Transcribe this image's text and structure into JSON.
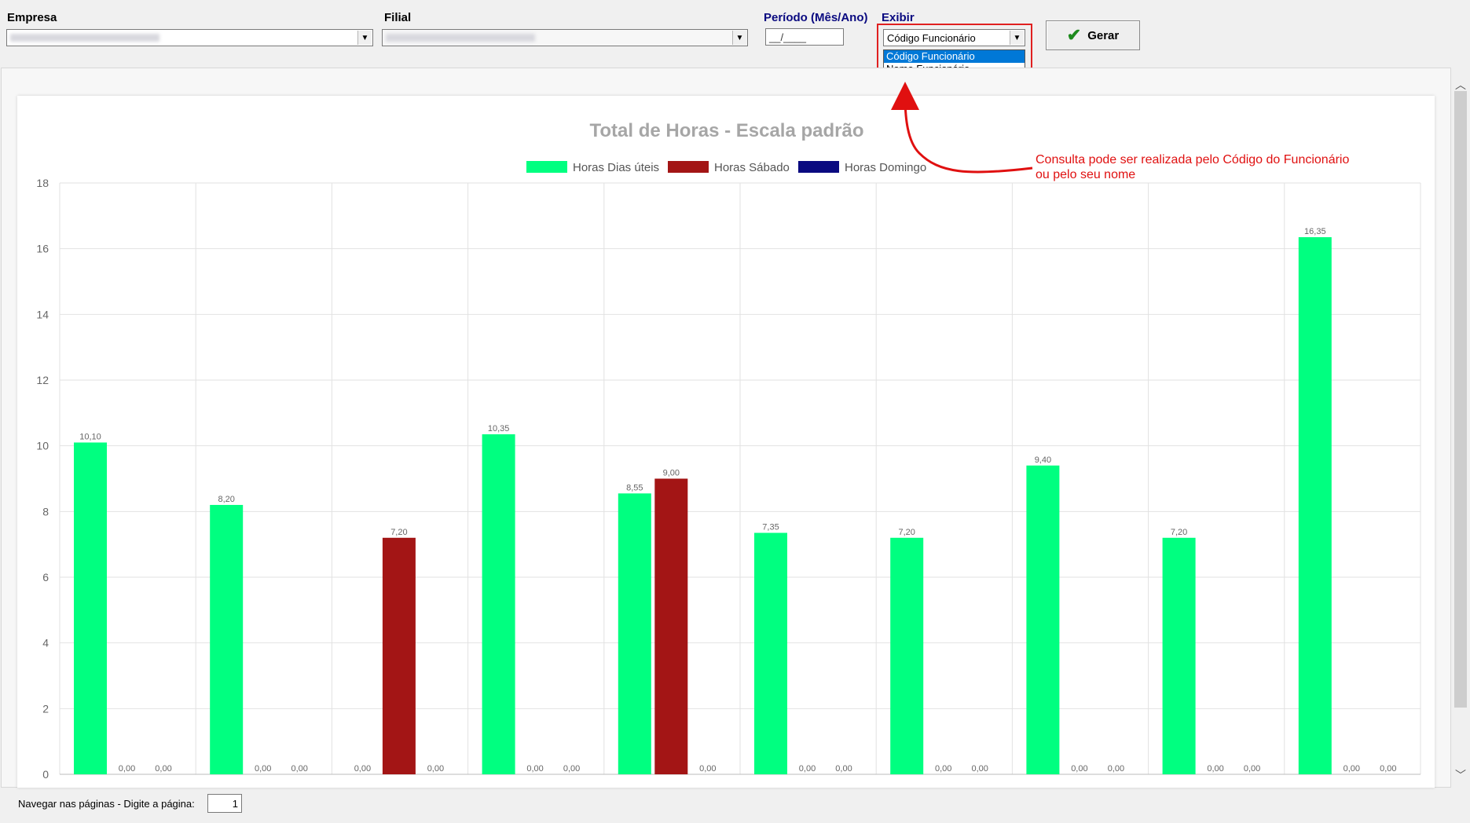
{
  "filters": {
    "empresa_label": "Empresa",
    "filial_label": "Filial",
    "periodo_label": "Período (Mês/Ano)",
    "periodo_value": "__/____",
    "exibir_label": "Exibir",
    "exibir_value": "Código Funcionário",
    "exibir_options": [
      "Código Funcionário",
      "Nome Funcionário"
    ],
    "gerar_label": "Gerar"
  },
  "annotation": {
    "line1": "Consulta pode ser realizada pelo Código do Funcionário",
    "line2": "ou pelo seu nome"
  },
  "navigation": {
    "label": "Navegar nas páginas - Digite a página:",
    "page": "1"
  },
  "colors": {
    "uteis": "#00ff80",
    "sabado": "#a31515",
    "domingo": "#0a0a80",
    "annotation": "#e01010"
  },
  "chart_data": {
    "type": "bar",
    "title": "Total de Horas - Escala padrão",
    "ylim": [
      0,
      18
    ],
    "yticks": [
      "0",
      "2",
      "4",
      "6",
      "8",
      "10",
      "12",
      "14",
      "16",
      "18"
    ],
    "categories": [
      "",
      "",
      "",
      "",
      "",
      "",
      "",
      "",
      "",
      ""
    ],
    "series": [
      {
        "name": "Horas Dias úteis",
        "values": [
          10.1,
          8.2,
          0,
          10.35,
          8.55,
          7.35,
          7.2,
          9.4,
          7.2,
          16.35
        ],
        "labels": [
          "10,10",
          "8,20",
          "0,00",
          "10,35",
          "8,55",
          "7,35",
          "7,20",
          "9,40",
          "7,20",
          "16,35"
        ]
      },
      {
        "name": "Horas Sábado",
        "values": [
          0,
          0,
          7.2,
          0,
          9.0,
          0,
          0,
          0,
          0,
          0
        ],
        "labels": [
          "0,00",
          "0,00",
          "7,20",
          "0,00",
          "9,00",
          "0,00",
          "0,00",
          "0,00",
          "0,00",
          "0,00"
        ]
      },
      {
        "name": "Horas Domingo",
        "values": [
          0,
          0,
          0,
          0,
          0,
          0,
          0,
          0,
          0,
          0
        ],
        "labels": [
          "0,00",
          "0,00",
          "0,00",
          "0,00",
          "0,00",
          "0,00",
          "0,00",
          "0,00",
          "0,00",
          "0,00"
        ]
      }
    ],
    "legend_position": "top-center",
    "grid": true
  }
}
